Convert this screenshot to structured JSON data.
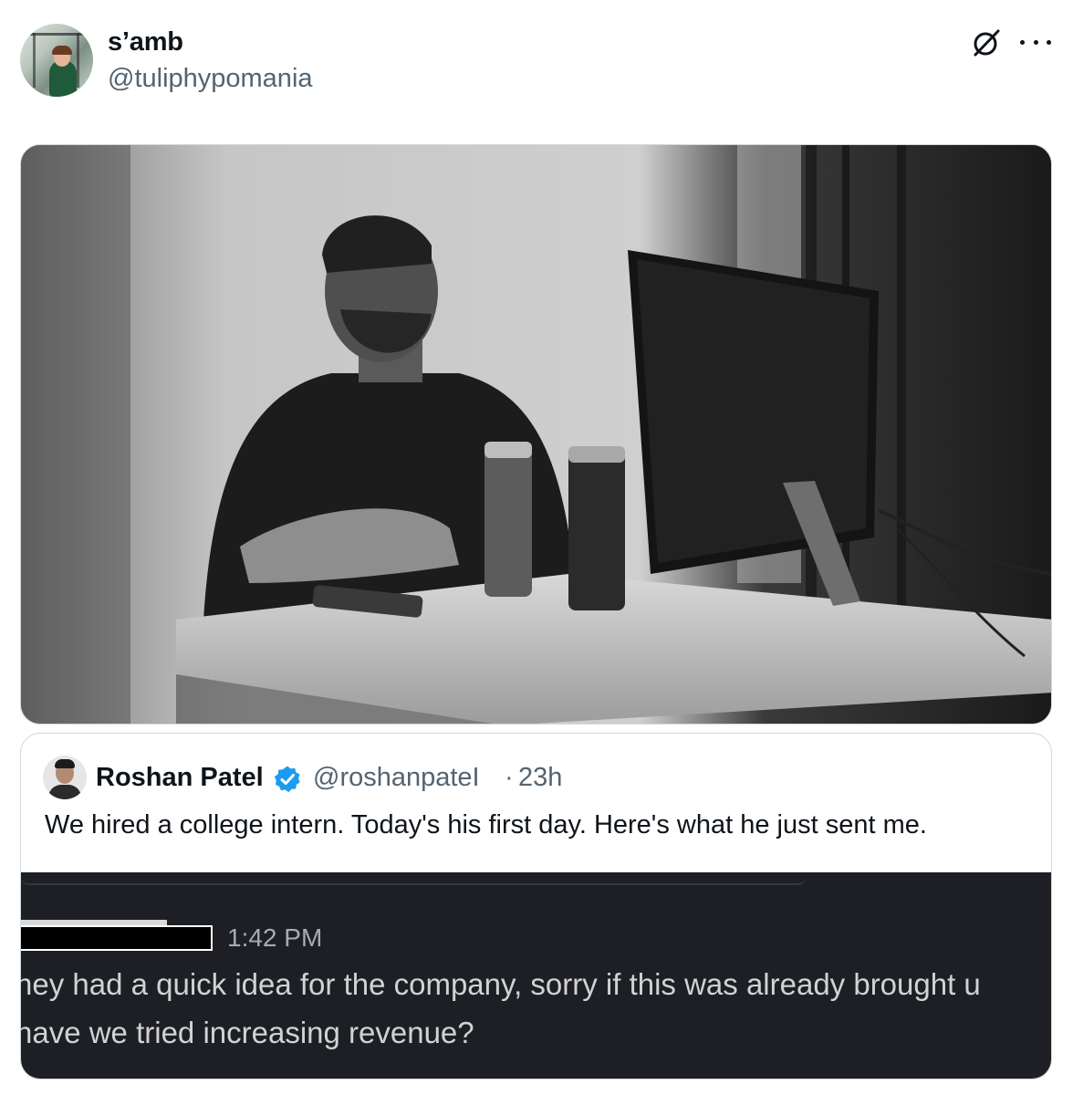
{
  "post": {
    "author": {
      "display_name": "s’amb",
      "handle": "@tuliphypomania"
    },
    "icons": {
      "grok": "grok-icon",
      "more": "more-icon"
    }
  },
  "quoted_post": {
    "author": {
      "display_name": "Roshan Patel",
      "handle": "@roshanpateI",
      "verified": true
    },
    "separator": "·",
    "time": "23h",
    "text": "We hired a college intern. Today's his first day. Here's what he just sent me.",
    "screenshot": {
      "time": "1:42 PM",
      "line1": "hey had a quick idea for the company, sorry if this was already brought u",
      "line2": "have we tried increasing revenue?"
    }
  },
  "colors": {
    "text_primary": "#0f1419",
    "text_secondary": "#536471",
    "border": "#cfd9de",
    "verified_blue": "#1d9bf0",
    "slack_bg": "#1e1f24",
    "slack_text": "#d1d2d3"
  }
}
